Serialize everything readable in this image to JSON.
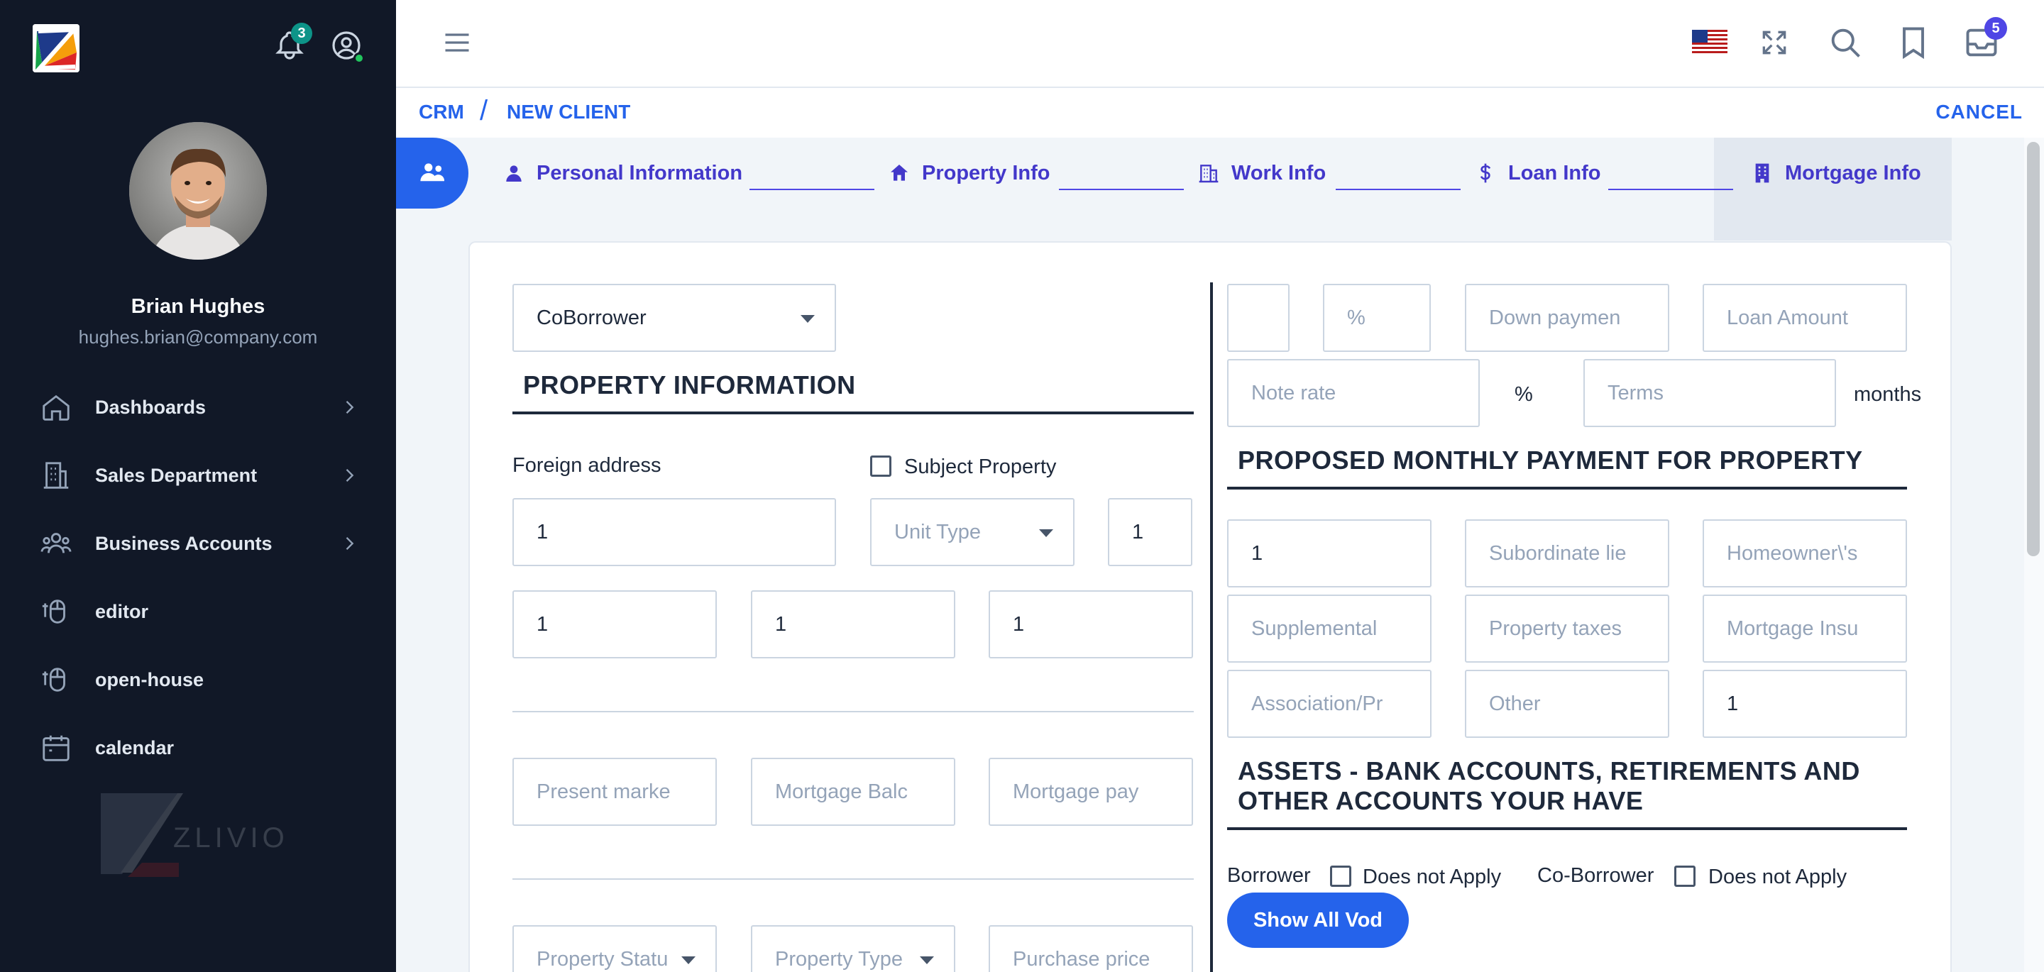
{
  "sidebar": {
    "notifications_count": "3",
    "user": {
      "name": "Brian Hughes",
      "email": "hughes.brian@company.com"
    },
    "nav": [
      {
        "label": "Dashboards",
        "icon": "home-icon",
        "has_children": true
      },
      {
        "label": "Sales Department",
        "icon": "building-icon",
        "has_children": true
      },
      {
        "label": "Business Accounts",
        "icon": "user-group-icon",
        "has_children": true
      },
      {
        "label": "editor",
        "icon": "mouse-icon",
        "has_children": false
      },
      {
        "label": "open-house",
        "icon": "mouse-icon",
        "has_children": false
      },
      {
        "label": "calendar",
        "icon": "calendar-icon",
        "has_children": false
      }
    ],
    "watermark_text": "ZLIVIO"
  },
  "topbar": {
    "mail_count": "5"
  },
  "breadcrumb": {
    "root": "CRM",
    "separator": "/",
    "current": "NEW CLIENT",
    "cancel": "CANCEL"
  },
  "stepper": {
    "steps": [
      {
        "label": "Personal Information",
        "icon": "user-icon"
      },
      {
        "label": "Property Info",
        "icon": "home-icon"
      },
      {
        "label": "Work Info",
        "icon": "office-building-icon"
      },
      {
        "label": "Loan Info",
        "icon": "dollar-icon"
      },
      {
        "label": "Mortgage Info",
        "icon": "office-icon"
      }
    ],
    "active_step": "Mortgage Info"
  },
  "left_form": {
    "borrower_select": "CoBorrower",
    "section_title": "PROPERTY INFORMATION",
    "foreign_address_label": "Foreign address",
    "subject_property_label": "Subject Property",
    "address_value": "1",
    "unit_type_placeholder": "Unit Type",
    "unit_number_value": "1",
    "city_value": "1",
    "state_value": "1",
    "zip_value": "1",
    "present_market_placeholder": "Present marke",
    "mortgage_balance_placeholder": "Mortgage Balc",
    "mortgage_payment_placeholder": "Mortgage pay",
    "property_status_placeholder": "Property Statu",
    "property_type_placeholder": "Property Type",
    "purchase_price_placeholder": "Purchase price"
  },
  "right_form": {
    "percent_placeholder": "%",
    "down_payment_placeholder": "Down paymen",
    "loan_amount_placeholder": "Loan Amount",
    "note_rate_placeholder": "Note rate",
    "note_rate_unit": "%",
    "terms_placeholder": "Terms",
    "terms_unit": "months",
    "payment_section_title": "PROPOSED MONTHLY PAYMENT FOR PROPERTY",
    "first_mortgage_value": "1",
    "subordinate_placeholder": "Subordinate lie",
    "homeowner_placeholder": "Homeowner\\'s",
    "supplemental_placeholder": "Supplemental",
    "property_taxes_placeholder": "Property taxes",
    "mortgage_insurance_placeholder": "Mortgage Insu",
    "association_placeholder": "Association/Pr",
    "other_placeholder": "Other",
    "total_value": "1",
    "assets_title_line1": "ASSETS - BANK ACCOUNTS, RETIREMENTS AND",
    "assets_title_line2": "OTHER ACCOUNTS YOUR HAVE",
    "borrower_label": "Borrower",
    "borrower_dna_label": "Does not Apply",
    "coborrower_label": "Co-Borrower",
    "coborrower_dna_label": "Does not Apply",
    "show_all_button": "Show All Vod"
  },
  "colors": {
    "sidebar_bg": "#111827",
    "accent": "#2563eb",
    "indigo": "#4338ca",
    "badge_teal": "#0d9488"
  }
}
